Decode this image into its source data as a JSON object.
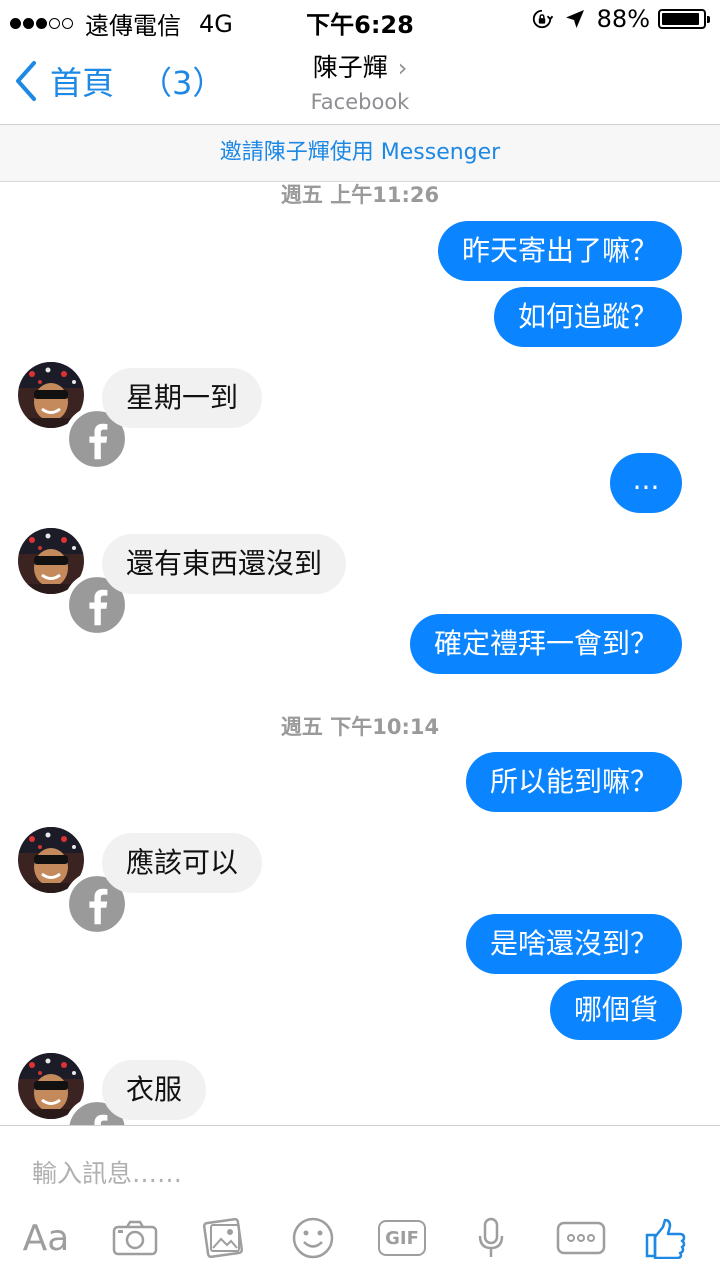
{
  "status_bar": {
    "carrier": "遠傳電信",
    "network": "4G",
    "time": "下午6:28",
    "battery": "88%",
    "signal_bars": 3
  },
  "nav": {
    "back_label": "首頁",
    "back_count": "（3）",
    "title": "陳子輝",
    "title_chevron": "›",
    "subtitle": "Facebook"
  },
  "invite_banner": "邀請陳子輝使用 Messenger",
  "messages": [
    {
      "type": "timestamp",
      "text": "週五 上午11:26"
    },
    {
      "type": "out",
      "text": "昨天寄出了嘛？"
    },
    {
      "type": "out",
      "text": "如何追蹤？"
    },
    {
      "type": "in",
      "text": "星期一到"
    },
    {
      "type": "out",
      "text": "..."
    },
    {
      "type": "in",
      "text": "還有東西還沒到"
    },
    {
      "type": "out",
      "text": "確定禮拜一會到？"
    },
    {
      "type": "timestamp",
      "text": "週五 下午10:14"
    },
    {
      "type": "out",
      "text": "所以能到嘛？"
    },
    {
      "type": "in",
      "text": "應該可以"
    },
    {
      "type": "out",
      "text": "是啥還沒到？"
    },
    {
      "type": "out",
      "text": "哪個貨"
    },
    {
      "type": "in",
      "text": "衣服"
    }
  ],
  "composer": {
    "placeholder": "輸入訊息……",
    "tools": [
      {
        "name": "text-format",
        "label": "Aa",
        "icon": "text-format-icon"
      },
      {
        "name": "camera",
        "icon": "camera-icon"
      },
      {
        "name": "gallery",
        "icon": "gallery-icon"
      },
      {
        "name": "sticker",
        "icon": "smiley-icon"
      },
      {
        "name": "gif",
        "label": "GIF",
        "icon": "gif-icon"
      },
      {
        "name": "voice",
        "icon": "microphone-icon"
      },
      {
        "name": "more",
        "icon": "more-icon"
      },
      {
        "name": "like",
        "icon": "thumbs-up-icon"
      }
    ]
  },
  "colors": {
    "accent": "#1e88e5",
    "outgoing_bubble": "#0a84ff",
    "incoming_bubble": "#f1f1f1"
  }
}
